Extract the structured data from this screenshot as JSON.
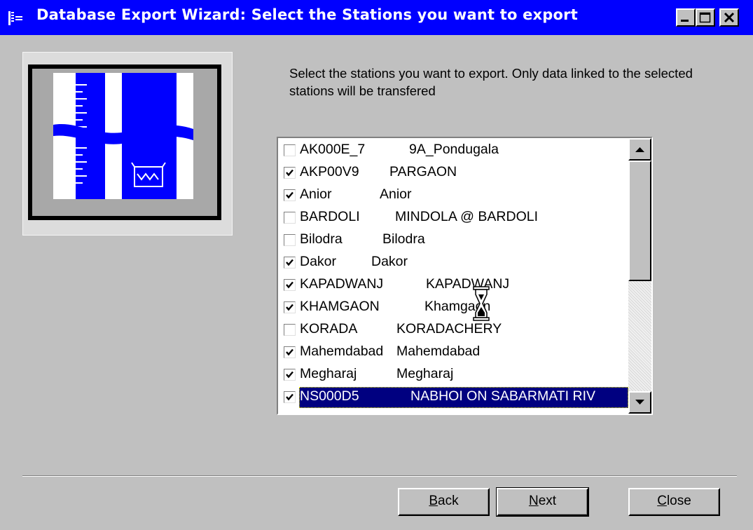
{
  "window": {
    "title": "Database Export Wizard: Select the Stations you want to export",
    "controls": [
      "minimize-icon",
      "maximize-icon",
      "close-icon"
    ]
  },
  "instruction": "Select the stations you want to export. Only data linked to the selected stations will be transfered",
  "stations": [
    {
      "code": "AK000E_7",
      "name": "9A_Pondugala",
      "checked": false
    },
    {
      "code": "AKP00V9",
      "name": "PARGAON",
      "checked": true
    },
    {
      "code": "Anior",
      "name": "Anior",
      "checked": true
    },
    {
      "code": "BARDOLI",
      "name": "MINDOLA @ BARDOLI",
      "checked": false
    },
    {
      "code": "Bilodra",
      "name": "Bilodra",
      "checked": false
    },
    {
      "code": "Dakor",
      "name": "Dakor",
      "checked": true
    },
    {
      "code": "KAPADWANJ",
      "name": "KAPADWANJ",
      "checked": true
    },
    {
      "code": "KHAMGAON",
      "name": "Khamgaon",
      "checked": true
    },
    {
      "code": "KORADA",
      "name": "KORADACHERY",
      "checked": false
    },
    {
      "code": "Mahemdabad",
      "name": "Mahemdabad",
      "checked": true
    },
    {
      "code": "Megharaj",
      "name": "Megharaj",
      "checked": true
    },
    {
      "code": "NS000D5",
      "name": "NABHOI ON SABARMATI RIV",
      "checked": true,
      "selected": true
    }
  ],
  "buttons": {
    "back": {
      "mnemonic": "B",
      "rest": "ack"
    },
    "next": {
      "mnemonic": "N",
      "rest": "ext"
    },
    "close": {
      "mnemonic": "C",
      "rest": "lose"
    }
  },
  "colors": {
    "titlebar": "#0000ff",
    "face": "#c0c0c0",
    "selection": "#000080",
    "illustration_blue": "#0000ff"
  },
  "icons": {
    "app": "wizard-app-icon",
    "cursor": "hourglass-cursor-icon",
    "illustration": "water-gauge-illustration"
  }
}
